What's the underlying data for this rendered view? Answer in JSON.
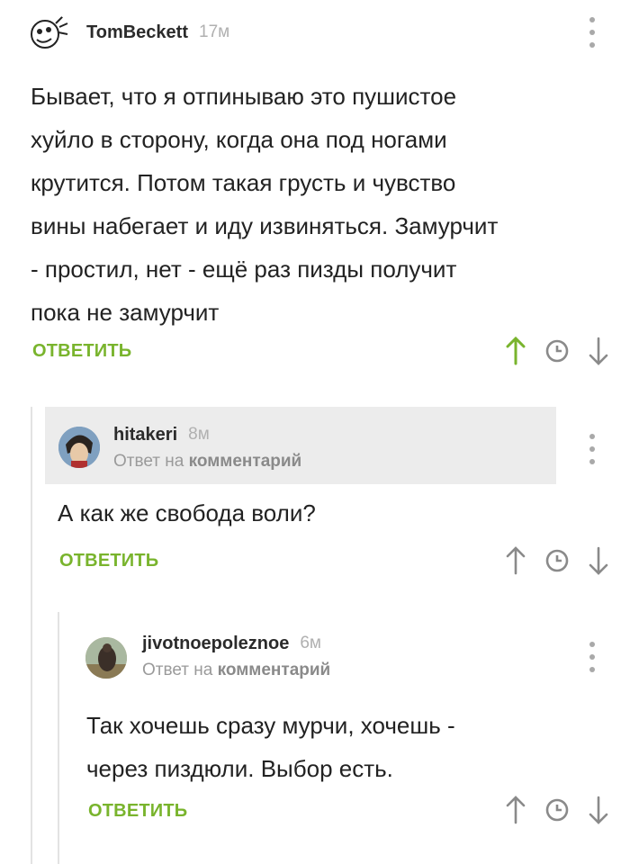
{
  "comments": [
    {
      "username": "TomBeckett",
      "time": "17м",
      "text_lines": [
        "Бывает, что я отпинываю это пушистое",
        "хуйло в сторону, когда она под ногами",
        "крутится. Потом такая грусть и чувство",
        "вины набегает и иду извиняться. Замурчит",
        "- простил, нет - ещё раз пизды получит",
        "пока не замурчит"
      ],
      "reply_label": "ОТВЕТИТЬ",
      "upvoted": true
    },
    {
      "username": "hitakeri",
      "time": "8м",
      "reply_to_prefix": "Ответ на",
      "reply_to_target": "комментарий",
      "text_lines": [
        "А как же свобода воли?"
      ],
      "reply_label": "ОТВЕТИТЬ",
      "upvoted": false
    },
    {
      "username": "jivotnoepoleznoe",
      "time": "6м",
      "reply_to_prefix": "Ответ на",
      "reply_to_target": "комментарий",
      "text_lines": [
        "Так хочешь сразу мурчи, хочешь -",
        "через пиздюли. Выбор есть."
      ],
      "reply_label": "ОТВЕТИТЬ",
      "upvoted": false
    }
  ],
  "icons": {
    "upvote": "arrow-up-icon",
    "history": "clock-icon",
    "downvote": "arrow-down-icon",
    "menu": "more-vertical-icon"
  },
  "colors": {
    "accent": "#79b42d",
    "icon_gray": "#8a8a8a",
    "thread_line": "#e3e3e3",
    "highlight_bg": "#ececec"
  }
}
